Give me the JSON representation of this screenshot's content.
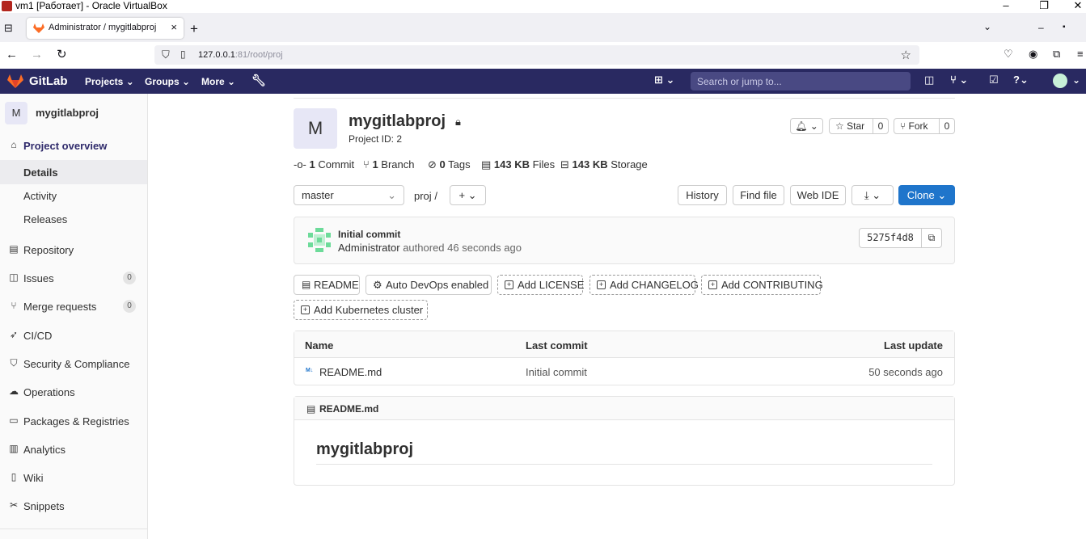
{
  "vbox": {
    "title": "vm1 [Работает] - Oracle VirtualBox"
  },
  "browser": {
    "tab_title": "Administrator / mygitlabproj",
    "url_host": "127.0.0.1",
    "url_rest": ":81/root/proj"
  },
  "gitlab_header": {
    "logo_text": "GitLab",
    "menus": [
      "Projects",
      "Groups",
      "More"
    ],
    "search_placeholder": "Search or jump to..."
  },
  "sidebar": {
    "project_avatar": "M",
    "project_name": "mygitlabproj",
    "overview_label": "Project overview",
    "sub_items": [
      "Details",
      "Activity",
      "Releases"
    ],
    "items": [
      {
        "label": "Repository",
        "icon": "document-icon"
      },
      {
        "label": "Issues",
        "icon": "issues-icon",
        "badge": "0"
      },
      {
        "label": "Merge requests",
        "icon": "merge-request-icon",
        "badge": "0"
      },
      {
        "label": "CI/CD",
        "icon": "rocket-icon"
      },
      {
        "label": "Security & Compliance",
        "icon": "shield-icon"
      },
      {
        "label": "Operations",
        "icon": "cloud-icon"
      },
      {
        "label": "Packages & Registries",
        "icon": "package-icon"
      },
      {
        "label": "Analytics",
        "icon": "chart-icon"
      },
      {
        "label": "Wiki",
        "icon": "book-icon"
      },
      {
        "label": "Snippets",
        "icon": "scissors-icon"
      }
    ]
  },
  "project": {
    "avatar": "M",
    "name": "mygitlabproj",
    "project_id": "Project ID: 2",
    "star_label": "Star",
    "star_count": "0",
    "fork_label": "Fork",
    "fork_count": "0"
  },
  "stats": {
    "commits_num": "1",
    "commits_label": "Commit",
    "branches_num": "1",
    "branches_label": "Branch",
    "tags_num": "0",
    "tags_label": "Tags",
    "files_num": "143 KB",
    "files_label": "Files",
    "storage_num": "143 KB",
    "storage_label": "Storage"
  },
  "toolbar": {
    "branch": "master",
    "path": "proj",
    "path_sep": "/",
    "history": "History",
    "find_file": "Find file",
    "web_ide": "Web IDE",
    "clone": "Clone"
  },
  "last_commit": {
    "title": "Initial commit",
    "author": "Administrator",
    "authored": "authored 46 seconds ago",
    "sha": "5275f4d8"
  },
  "quick_actions": {
    "readme": "README",
    "auto_devops": "Auto DevOps enabled",
    "add_license": "Add LICENSE",
    "add_changelog": "Add CHANGELOG",
    "add_contributing": "Add CONTRIBUTING",
    "add_k8s": "Add Kubernetes cluster"
  },
  "file_table": {
    "headers": [
      "Name",
      "Last commit",
      "Last update"
    ],
    "rows": [
      {
        "name": "README.md",
        "commit": "Initial commit",
        "updated": "50 seconds ago"
      }
    ]
  },
  "readme": {
    "filename": "README.md",
    "heading": "mygitlabproj"
  },
  "colors": {
    "header_bg": "#292961",
    "clone_btn": "#1f75cb",
    "accent_orange": "#fc6d26"
  }
}
